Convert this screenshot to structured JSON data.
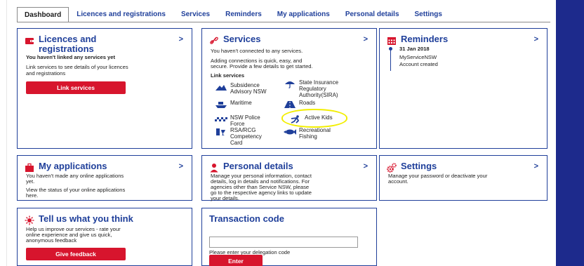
{
  "tabs": [
    "Dashboard",
    "Licences and registrations",
    "Services",
    "Reminders",
    "My applications",
    "Personal details",
    "Settings"
  ],
  "licences": {
    "title_l1": "Licences and",
    "title_l2": "registrations",
    "heading": "You haven't linked any services yet",
    "text_l1": "Link services to see details of your licences",
    "text_l2": "and registrations",
    "button": "Link services",
    "chevron": ">"
  },
  "services": {
    "title": "Services",
    "chevron": ">",
    "intro": "You haven't connected to any services.",
    "text_l1": "Adding connections is quick, easy, and",
    "text_l2": "secure. Provide a few details to get started.",
    "heading": "Link services",
    "items": [
      {
        "l1": "Subsidence",
        "l2": "Advisory NSW",
        "l3": ""
      },
      {
        "l1": "State Insurance",
        "l2": "Regulatory",
        "l3": "Authority(SIRA)"
      },
      {
        "l1": "Maritime",
        "l2": "",
        "l3": ""
      },
      {
        "l1": "Roads",
        "l2": "",
        "l3": ""
      },
      {
        "l1": "NSW Police",
        "l2": "Force",
        "l3": ""
      },
      {
        "l1": "Active Kids",
        "l2": "",
        "l3": ""
      },
      {
        "l1": "RSA/RCG",
        "l2": "Competency",
        "l3": "Card"
      },
      {
        "l1": "Recreational",
        "l2": "Fishing",
        "l3": ""
      }
    ]
  },
  "reminders": {
    "title": "Reminders",
    "chevron": ">",
    "date": "31 Jan 2018",
    "line1": "MyServiceNSW",
    "line2": "Account created"
  },
  "applications": {
    "title": "My applications",
    "chevron": ">",
    "text_l1": "You haven't made any online applications",
    "text_l2": "yet.",
    "text_l3": "View the status of your online applications",
    "text_l4": "here."
  },
  "personal": {
    "title": "Personal details",
    "chevron": ">",
    "l1": "Manage your personal information, contact",
    "l2": "details, log in details and notifications. For",
    "l3": "agencies other than Service NSW, please",
    "l4": "go to the respective agency links to update",
    "l5": "your details."
  },
  "settings": {
    "title": "Settings",
    "chevron": ">",
    "l1": "Manage your password or deactivate your",
    "l2": "account."
  },
  "feedback": {
    "title": "Tell us what you think",
    "l1": "Help us improve our services - rate your",
    "l2": "online experience and give us quick,",
    "l3": "anonymous feedback",
    "button": "Give feedback"
  },
  "transaction": {
    "title": "Transaction code",
    "input_value": "",
    "hint": "Please enter your delegation code",
    "button": "Enter"
  },
  "colors": {
    "brand": "#1f3f9a",
    "accent": "#d7152d",
    "highlight": "#f2ee00",
    "background": "#1d2a8c"
  }
}
